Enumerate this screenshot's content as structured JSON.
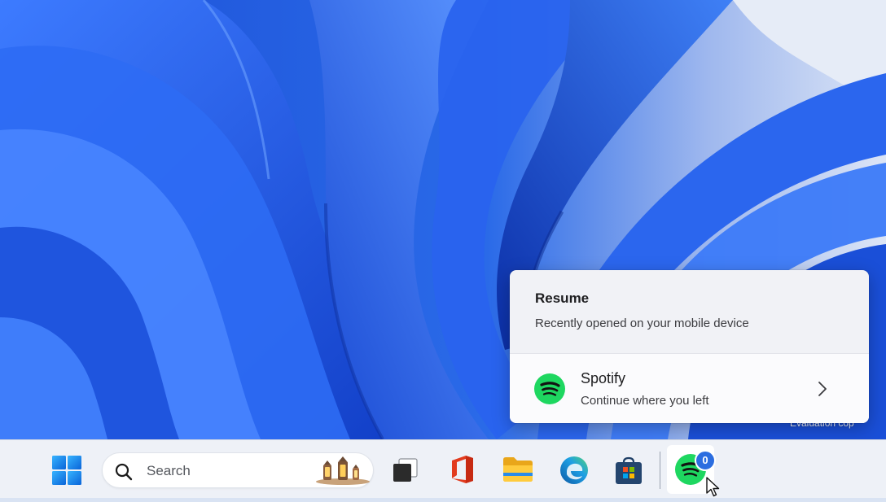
{
  "flyout": {
    "title": "Resume",
    "subtitle": "Recently opened on your mobile device",
    "item": {
      "app_name": "Spotify",
      "description": "Continue where you left",
      "icon": "spotify-icon"
    }
  },
  "taskbar": {
    "search_placeholder": "Search",
    "apps": [
      "start-icon",
      "task-view-icon",
      "office-icon",
      "file-explorer-icon",
      "edge-icon",
      "store-icon",
      "spotify-icon"
    ],
    "spotify_badge": "0"
  },
  "watermark": "Evaluation cop",
  "colors": {
    "accent": "#2b6de0",
    "spotify_green": "#1ed760",
    "wallpaper_blue": "#1f5fe0"
  }
}
